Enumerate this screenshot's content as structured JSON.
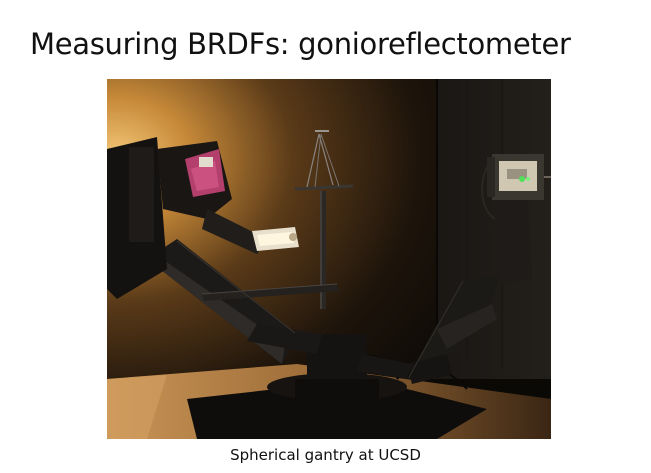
{
  "slide": {
    "title": "Measuring BRDFs: gonioreflectometer",
    "caption": "Spherical gantry at UCSD"
  },
  "photo": {
    "subject": "gonioreflectometer-spherical-gantry",
    "colors": {
      "light": "#e8b25a",
      "dark": "#0b0906",
      "arm": "#1c1a18",
      "pink": "#c0497a",
      "led": "#52e05a"
    }
  }
}
